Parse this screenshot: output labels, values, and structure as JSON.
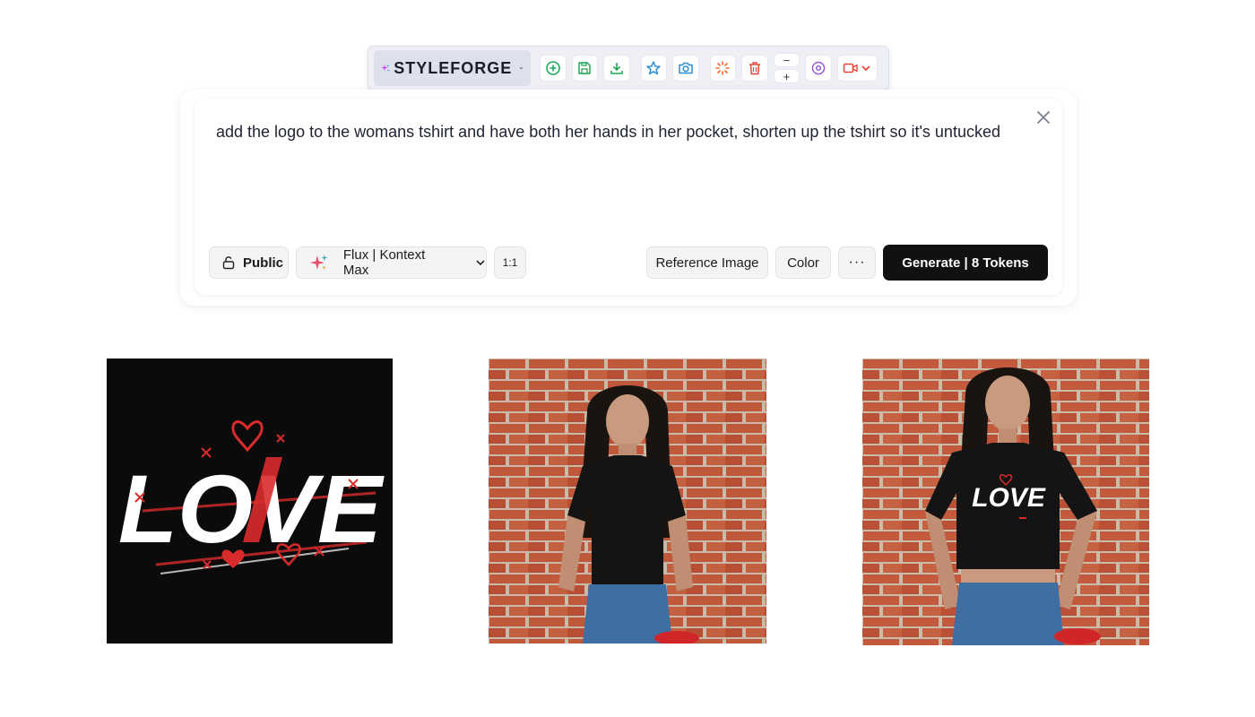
{
  "toolbar": {
    "brand_name": "STYLEFORGE",
    "icons": [
      "add-circle-icon",
      "save-icon",
      "download-icon",
      "star-icon",
      "camera-icon",
      "sparkle-burst-icon",
      "trash-icon",
      "zoom-out-icon",
      "zoom-in-icon",
      "target-icon",
      "video-icon"
    ],
    "zoom_out_label": "−",
    "zoom_in_label": "+"
  },
  "prompt": {
    "text": "add the logo to the womans tshirt and have both her hands in her pocket, shorten up the tshirt so it's untucked"
  },
  "controls": {
    "visibility_label": "Public",
    "model_label": "Flux | Kontext Max",
    "ratio_label": "1:1",
    "reference_label": "Reference Image",
    "color_label": "Color",
    "more_label": "···",
    "generate_label": "Generate | 8 Tokens"
  },
  "images": {
    "logo_text": "LOVE",
    "shirt_logo_text": "LOVE"
  },
  "colors": {
    "brand_magenta": "#d63cf0",
    "brand_teal": "#2bb6c9",
    "green": "#1faa59",
    "blue": "#2a8fd6",
    "orange": "#f06a2a",
    "red_trash": "#e4483a",
    "purple": "#9b59d0",
    "brick": "#b5543a",
    "love_red": "#d92b2b"
  }
}
